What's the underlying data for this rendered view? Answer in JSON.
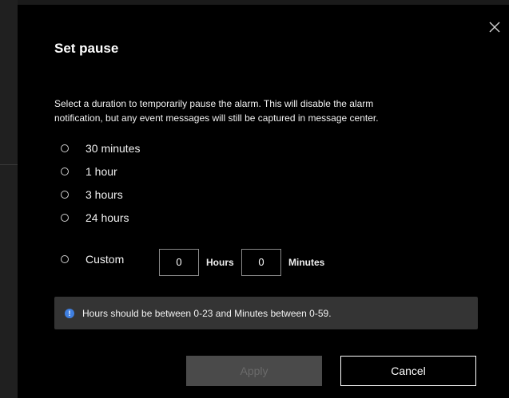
{
  "dialog": {
    "title": "Set pause",
    "description_line1": "Select a duration to temporarily pause the alarm. This will disable the alarm",
    "description_line2": "notification, but any event messages will still be captured in message center.",
    "options": [
      {
        "label": "30 minutes"
      },
      {
        "label": "1 hour"
      },
      {
        "label": "3 hours"
      },
      {
        "label": "24 hours"
      },
      {
        "label": "Custom"
      }
    ],
    "custom": {
      "hours_value": "0",
      "hours_unit": "Hours",
      "minutes_value": "0",
      "minutes_unit": "Minutes"
    },
    "info": {
      "icon": "info-icon",
      "glyph": "!",
      "text": "Hours should be between 0-23 and Minutes between 0-59."
    },
    "buttons": {
      "apply": "Apply",
      "cancel": "Cancel"
    },
    "close_icon": "close-icon"
  },
  "colors": {
    "dialog_bg": "#000000",
    "info_bar_bg": "#343434",
    "info_icon": "#3f7fe0",
    "apply_disabled_bg": "#4a4a4a",
    "apply_disabled_text": "#6a6a6a"
  }
}
